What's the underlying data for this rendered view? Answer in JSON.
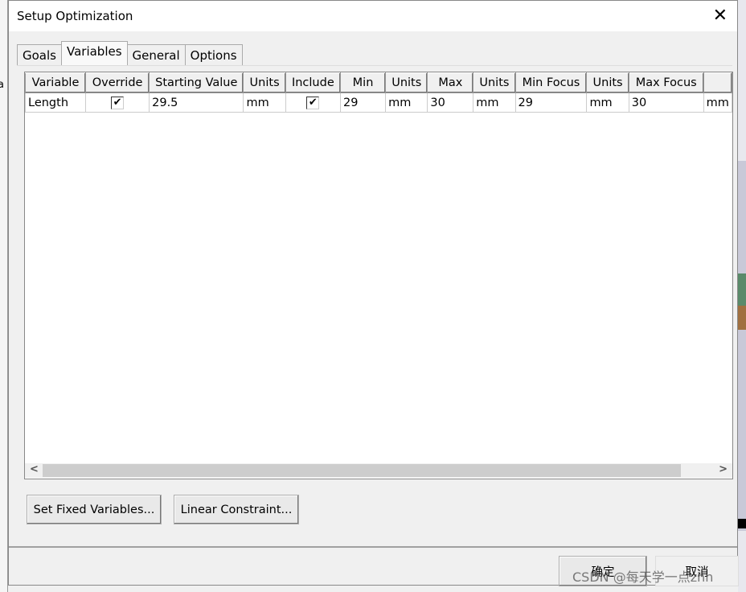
{
  "background": {
    "left_fragment": "a"
  },
  "dialog": {
    "title": "Setup Optimization",
    "close_glyph": "✕",
    "tabs": [
      {
        "label": "Goals"
      },
      {
        "label": "Variables",
        "active": true
      },
      {
        "label": "General"
      },
      {
        "label": "Options"
      }
    ],
    "table": {
      "columns": [
        "Variable",
        "Override",
        "Starting Value",
        "Units",
        "Include",
        "Min",
        "Units",
        "Max",
        "Units",
        "Min Focus",
        "Units",
        "Max Focus",
        ""
      ],
      "rows": [
        {
          "variable": "Length",
          "override": true,
          "starting_value": "29.5",
          "units1": "mm",
          "include": true,
          "min": "29",
          "units2": "mm",
          "max": "30",
          "units3": "mm",
          "min_focus": "29",
          "units4": "mm",
          "max_focus": "30",
          "units5": "mm"
        }
      ]
    },
    "buttons": {
      "set_fixed": "Set Fixed Variables...",
      "linear": "Linear Constraint...",
      "ok": "确定",
      "cancel": "取消"
    },
    "scroll": {
      "left": "<",
      "right": ">"
    }
  },
  "watermark": "CSDN @每天学一点zhn",
  "check_glyph": "✔"
}
